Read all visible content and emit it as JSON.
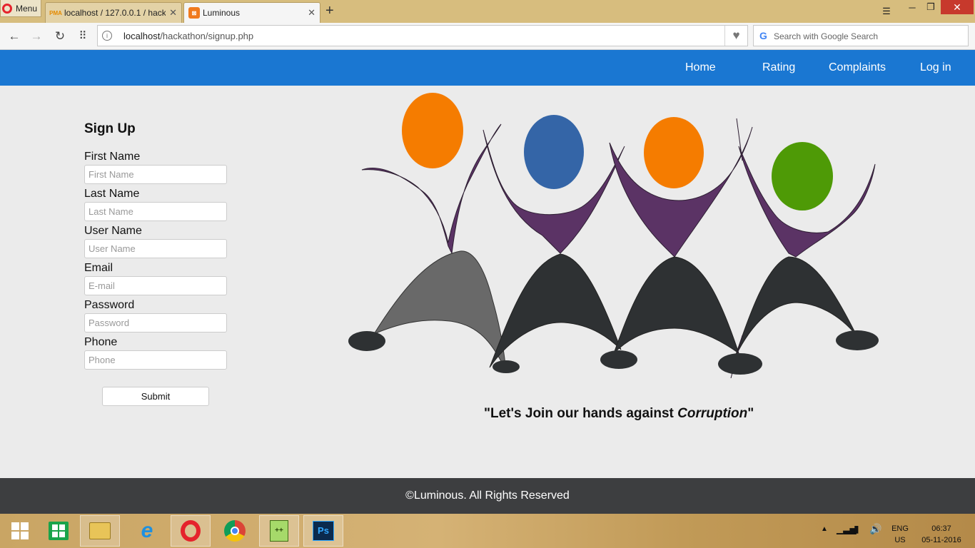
{
  "browser": {
    "menu_label": "Menu",
    "tabs": [
      {
        "title": "localhost / 127.0.0.1 / hackathon",
        "icon": "phpmyadmin-icon",
        "favicon_text": "PMA"
      },
      {
        "title": "Luminous",
        "icon": "xampp-icon",
        "favicon_text": "⊠"
      }
    ],
    "url_host": "localhost",
    "url_path": "/hackathon/signup.php",
    "search_placeholder": "Search with Google Search"
  },
  "page": {
    "nav": [
      "Home",
      "Rating",
      "Complaints",
      "Log in"
    ],
    "form": {
      "title": "Sign Up",
      "fields": [
        {
          "label": "First Name",
          "placeholder": "First Name"
        },
        {
          "label": "Last Name",
          "placeholder": "Last Name"
        },
        {
          "label": "User Name",
          "placeholder": "User Name"
        },
        {
          "label": "Email",
          "placeholder": "E-mail"
        },
        {
          "label": "Password",
          "placeholder": "Password"
        },
        {
          "label": "Phone",
          "placeholder": "Phone"
        }
      ],
      "submit_label": "Submit"
    },
    "slogan_prefix": "\"Let's Join our hands against ",
    "slogan_emphasis": "Corruption",
    "slogan_suffix": "\"",
    "footer_text": "©Luminous. All Rights Reserved"
  },
  "taskbar": {
    "apps": [
      "start-icon",
      "store-icon",
      "file-explorer-icon",
      "internet-explorer-icon",
      "opera-icon",
      "chrome-icon",
      "notepad-plus-plus-icon",
      "photoshop-icon"
    ],
    "lang": "ENG",
    "region": "US",
    "time": "06:37",
    "date": "05-11-2016"
  },
  "colors": {
    "header_blue": "#1a77d2",
    "footer": "#3d3e40",
    "person_orange": "#f57c00",
    "person_blue": "#3465a7",
    "person_green": "#4e9a06",
    "body_purple": "#5b3365",
    "legs_dark": "#2e3133",
    "legs_gray": "#696969"
  }
}
